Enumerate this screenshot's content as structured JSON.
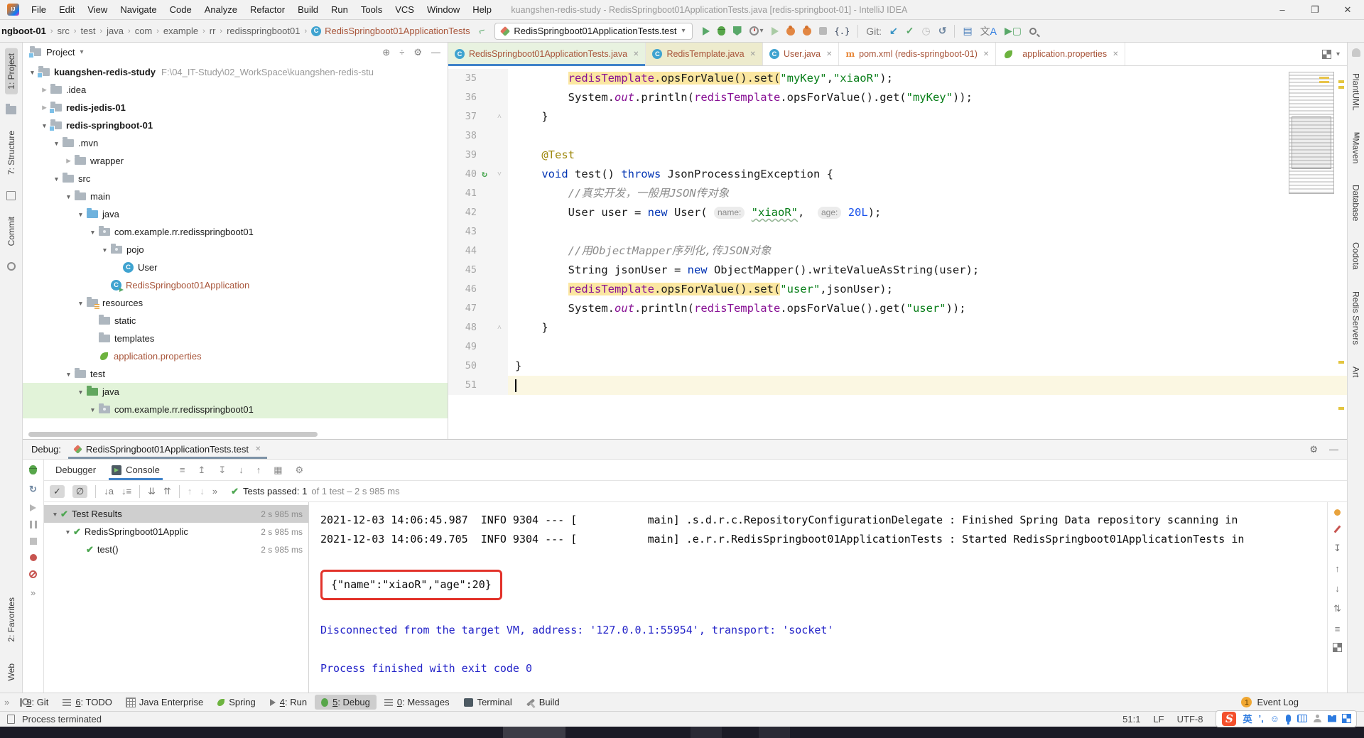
{
  "window": {
    "title": "kuangshen-redis-study - RedisSpringboot01ApplicationTests.java [redis-springboot-01] - IntelliJ IDEA",
    "menus": [
      "File",
      "Edit",
      "View",
      "Navigate",
      "Code",
      "Analyze",
      "Refactor",
      "Build",
      "Run",
      "Tools",
      "VCS",
      "Window",
      "Help"
    ],
    "controls": {
      "minimize": "–",
      "maximize": "❐",
      "close": "✕"
    }
  },
  "toolbar": {
    "breadcrumbs": [
      "ngboot-01",
      "src",
      "test",
      "java",
      "com",
      "example",
      "rr",
      "redisspringboot01",
      "RedisSpringboot01ApplicationTests"
    ],
    "run_config": "RedisSpringboot01ApplicationTests.test",
    "git_label": "Git:"
  },
  "stripes": {
    "left_top": [
      {
        "t": "tab",
        "label": "1: Project",
        "active": true
      },
      {
        "t": "icon",
        "name": "folder-icon",
        "cls": ""
      },
      {
        "t": "tab",
        "label": "7: Structure"
      },
      {
        "t": "icon",
        "name": "structure-grid-icon",
        "cls": "grid"
      },
      {
        "t": "tab",
        "label": "Commit"
      },
      {
        "t": "icon",
        "name": "commit-anchor-icon",
        "cls": "anchor"
      }
    ],
    "left_bottom": [
      {
        "t": "tab",
        "label": "2: Favorites"
      },
      {
        "t": "tab",
        "label": "Web"
      }
    ],
    "right_items": [
      {
        "t": "icon",
        "name": "notifications-icon",
        "cls": "bell"
      },
      {
        "t": "tab",
        "label": "PlantUML"
      },
      {
        "t": "tab",
        "label": "Maven",
        "mico": "M"
      },
      {
        "t": "tab",
        "label": "Database"
      },
      {
        "t": "tab",
        "label": "Codota"
      },
      {
        "t": "tab",
        "label": "Redis Servers"
      },
      {
        "t": "tab",
        "label": "Art"
      }
    ]
  },
  "project": {
    "header": "Project",
    "tree": [
      {
        "depth": 0,
        "type": "mod",
        "label": "kuangshen-redis-study",
        "bold": true,
        "chev": "exp",
        "path": "F:\\04_IT-Study\\02_WorkSpace\\kuangshen-redis-stu"
      },
      {
        "depth": 1,
        "type": "fold",
        "label": ".idea",
        "chev": "col"
      },
      {
        "depth": 1,
        "type": "mod",
        "label": "redis-jedis-01",
        "bold": true,
        "chev": "col"
      },
      {
        "depth": 1,
        "type": "mod",
        "label": "redis-springboot-01",
        "bold": true,
        "chev": "exp"
      },
      {
        "depth": 2,
        "type": "fold",
        "label": ".mvn",
        "chev": "exp"
      },
      {
        "depth": 3,
        "type": "fold",
        "label": "wrapper",
        "chev": "col"
      },
      {
        "depth": 2,
        "type": "fold",
        "label": "src",
        "chev": "exp"
      },
      {
        "depth": 3,
        "type": "fold",
        "label": "main",
        "chev": "exp"
      },
      {
        "depth": 4,
        "type": "foldb",
        "label": "java",
        "chev": "exp"
      },
      {
        "depth": 5,
        "type": "pkg",
        "label": "com.example.rr.redisspringboot01",
        "chev": "exp"
      },
      {
        "depth": 6,
        "type": "pkg",
        "label": "pojo",
        "chev": "exp"
      },
      {
        "depth": 7,
        "type": "cls",
        "label": "User"
      },
      {
        "depth": 6,
        "type": "clsrun",
        "label": "RedisSpringboot01Application",
        "color": "brown"
      },
      {
        "depth": 4,
        "type": "foldr",
        "label": "resources",
        "chev": "exp"
      },
      {
        "depth": 5,
        "type": "fold",
        "label": "static"
      },
      {
        "depth": 5,
        "type": "fold",
        "label": "templates"
      },
      {
        "depth": 5,
        "type": "leaf",
        "label": "application.properties",
        "color": "brown"
      },
      {
        "depth": 3,
        "type": "fold",
        "label": "test",
        "chev": "exp"
      },
      {
        "depth": 4,
        "type": "foldg",
        "label": "java",
        "chev": "exp",
        "highlight": true
      },
      {
        "depth": 5,
        "type": "pkg",
        "label": "com.example.rr.redisspringboot01",
        "chev": "exp",
        "highlight": true
      }
    ]
  },
  "editor": {
    "tabs": [
      {
        "icon": "class",
        "label": "RedisSpringboot01ApplicationTests.java",
        "state": "active"
      },
      {
        "icon": "class",
        "label": "RedisTemplate.java",
        "state": "yellow"
      },
      {
        "icon": "class",
        "label": "User.java",
        "state": ""
      },
      {
        "icon": "maven",
        "label": "pom.xml (redis-springboot-01)",
        "state": ""
      },
      {
        "icon": "spring",
        "label": "application.properties",
        "state": ""
      }
    ],
    "lines": [
      {
        "n": 35,
        "ind": 8,
        "tk": [
          [
            "f",
            "redisTemplate",
            1
          ],
          [
            "p",
            ".opsForValue().set(",
            1
          ],
          [
            "s",
            "\"myKey\""
          ],
          [
            "p",
            ","
          ],
          [
            "s",
            "\"xiaoR\""
          ],
          [
            "p",
            ");"
          ]
        ]
      },
      {
        "n": 36,
        "ind": 8,
        "tk": [
          [
            "p",
            "System."
          ],
          [
            "si",
            "out"
          ],
          [
            "p",
            ".println("
          ],
          [
            "f",
            "redisTemplate"
          ],
          [
            "p",
            ".opsForValue().get("
          ],
          [
            "s",
            "\"myKey\""
          ],
          [
            "p",
            "));"
          ]
        ]
      },
      {
        "n": 37,
        "ind": 4,
        "tk": [
          [
            "p",
            "}"
          ]
        ],
        "fold": "up"
      },
      {
        "n": 38,
        "ind": 0,
        "tk": []
      },
      {
        "n": 39,
        "ind": 4,
        "tk": [
          [
            "a",
            "@Test"
          ]
        ]
      },
      {
        "n": 40,
        "ind": 4,
        "tk": [
          [
            "k",
            "void"
          ],
          [
            "p",
            " test() "
          ],
          [
            "k",
            "throws"
          ],
          [
            "p",
            " JsonProcessingException {"
          ]
        ],
        "fold": "down",
        "runicon": true
      },
      {
        "n": 41,
        "ind": 8,
        "tk": [
          [
            "c",
            "//真实开发，一般用JSON传对象"
          ]
        ]
      },
      {
        "n": 42,
        "ind": 8,
        "tk": [
          [
            "p",
            "User user = "
          ],
          [
            "k",
            "new"
          ],
          [
            "p",
            " User( "
          ],
          [
            "h",
            "name:"
          ],
          [
            "p",
            " "
          ],
          [
            "sw",
            "\"xiaoR\""
          ],
          [
            "p",
            ",  "
          ],
          [
            "h",
            "age:"
          ],
          [
            "p",
            " "
          ],
          [
            "n",
            "20L"
          ],
          [
            "p",
            ");"
          ]
        ]
      },
      {
        "n": 43,
        "ind": 0,
        "tk": []
      },
      {
        "n": 44,
        "ind": 8,
        "tk": [
          [
            "c",
            "//用ObjectMapper序列化,传JSON对象"
          ]
        ]
      },
      {
        "n": 45,
        "ind": 8,
        "tk": [
          [
            "p",
            "String jsonUser = "
          ],
          [
            "k",
            "new"
          ],
          [
            "p",
            " ObjectMapper().writeValueAsString(user);"
          ]
        ]
      },
      {
        "n": 46,
        "ind": 8,
        "tk": [
          [
            "f",
            "redisTemplate",
            1
          ],
          [
            "p",
            ".opsForValue().set(",
            1
          ],
          [
            "s",
            "\"user\""
          ],
          [
            "p",
            ",jsonUser);"
          ]
        ]
      },
      {
        "n": 47,
        "ind": 8,
        "tk": [
          [
            "p",
            "System."
          ],
          [
            "si",
            "out"
          ],
          [
            "p",
            ".println("
          ],
          [
            "f",
            "redisTemplate"
          ],
          [
            "p",
            ".opsForValue().get("
          ],
          [
            "s",
            "\"user\""
          ],
          [
            "p",
            "));"
          ]
        ]
      },
      {
        "n": 48,
        "ind": 4,
        "tk": [
          [
            "p",
            "}"
          ]
        ],
        "fold": "up"
      },
      {
        "n": 49,
        "ind": 0,
        "tk": []
      },
      {
        "n": 50,
        "ind": 0,
        "tk": [
          [
            "p",
            "}"
          ]
        ]
      },
      {
        "n": 51,
        "ind": 0,
        "tk": [],
        "caret": true
      }
    ]
  },
  "debug": {
    "label": "Debug:",
    "session_tab": "RedisSpringboot01ApplicationTests.test",
    "tabs": [
      {
        "label": "Debugger",
        "active": false
      },
      {
        "label": "Console",
        "active": true
      }
    ],
    "status_check": "✔",
    "status_bold": "Tests passed: 1",
    "status_rest": " of 1 test – 2 s 985 ms",
    "test_tree": [
      {
        "label": "Test Results",
        "dur": "2 s 985 ms",
        "sel": true,
        "depth": 0,
        "chev": true
      },
      {
        "label": "RedisSpringboot01Applic",
        "dur": "2 s 985 ms",
        "sel": false,
        "depth": 1,
        "chev": true
      },
      {
        "label": "test()",
        "dur": "2 s 985 ms",
        "sel": false,
        "depth": 2,
        "chev": false
      }
    ],
    "console": [
      {
        "kind": "log",
        "text": "2021-12-03 14:06:45.987  INFO 9304 --- [           main] .s.d.r.c.RepositoryConfigurationDelegate : Finished Spring Data repository scanning in"
      },
      {
        "kind": "log",
        "text": "2021-12-03 14:06:49.705  INFO 9304 --- [           main] .e.r.r.RedisSpringboot01ApplicationTests : Started RedisSpringboot01ApplicationTests in"
      },
      {
        "kind": "blank",
        "text": ""
      },
      {
        "kind": "json",
        "text": "{\"name\":\"xiaoR\",\"age\":20}"
      },
      {
        "kind": "blank",
        "text": ""
      },
      {
        "kind": "sys",
        "text": "Disconnected from the target VM, address: '127.0.0.1:55954', transport: 'socket'"
      },
      {
        "kind": "blank",
        "text": ""
      },
      {
        "kind": "sys",
        "text": "Process finished with exit code 0"
      }
    ]
  },
  "winbar": {
    "items": [
      {
        "num": "9",
        "label": "Git",
        "ic": "gitb"
      },
      {
        "num": "6",
        "label": "TODO",
        "ic": "lines"
      },
      {
        "num": "",
        "label": "Java Enterprise",
        "ic": "grid"
      },
      {
        "num": "",
        "label": "Spring",
        "ic": "spring"
      },
      {
        "num": "4",
        "label": "Run",
        "ic": "run"
      },
      {
        "num": "5",
        "label": "Debug",
        "ic": "bugg",
        "active": true
      },
      {
        "num": "0",
        "label": "Messages",
        "ic": "lines"
      },
      {
        "num": "",
        "label": "Terminal",
        "ic": "term"
      },
      {
        "num": "",
        "label": "Build",
        "ic": "hammer"
      }
    ],
    "event_log": "Event Log",
    "event_badge": "1"
  },
  "statusbar": {
    "message": "Process terminated",
    "position": "51:1",
    "line_ending": "LF",
    "encoding": "UTF-8",
    "ime_lang": "英",
    "ime_punct": "’,",
    "ime_smiley": "☺"
  },
  "icons": {
    "caret_down": "▾",
    "crumb_sep": "›",
    "target": "⊕",
    "collapse": "÷",
    "gear": "⚙",
    "hide": "—",
    "close": "✕",
    "chevrons": "»",
    "check": "✓",
    "empty": "∅",
    "sort_a": "↓a",
    "sort_l": "↓≡",
    "expand_all": "⇊",
    "collapse_all": "⇈",
    "up": "↑",
    "down": "↓",
    "updown": "⇅",
    "menu": "≡",
    "down_bar": "↧",
    "up_bar": "↥",
    "rerun": "↻",
    "grid": "▦"
  }
}
